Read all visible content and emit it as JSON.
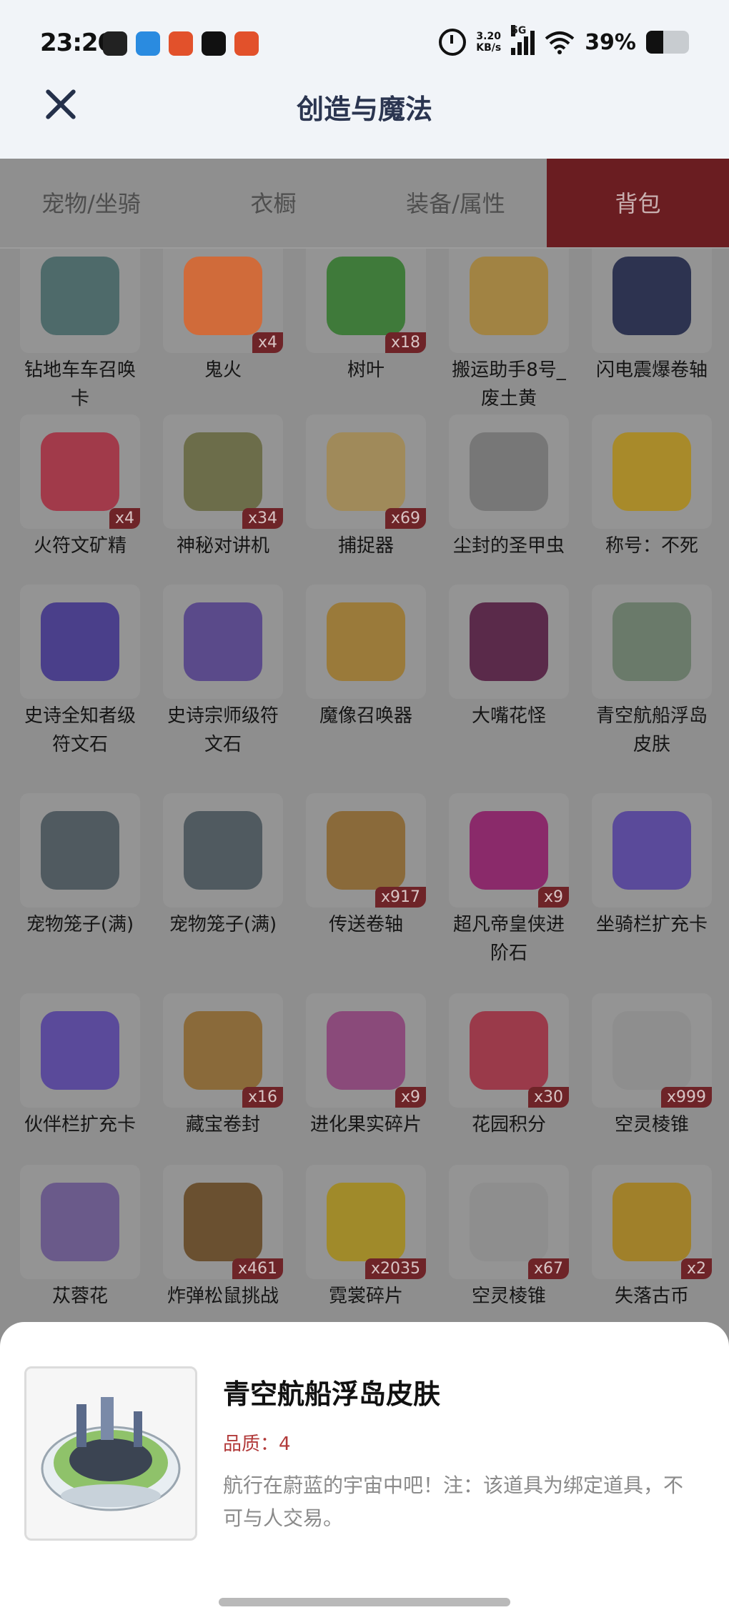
{
  "status_bar": {
    "time": "23:20",
    "net_speed_value": "3.20",
    "net_speed_unit": "KB/s",
    "network": "5G",
    "battery": "39%",
    "app_icon_colors": [
      "#222222",
      "#2a8be0",
      "#e2512b",
      "#111111",
      "#e2512b"
    ]
  },
  "header": {
    "title": "创造与魔法",
    "close_icon": "close-icon"
  },
  "tabs": [
    {
      "label": "宠物/坐骑",
      "active": false
    },
    {
      "label": "衣橱",
      "active": false
    },
    {
      "label": "装备/属性",
      "active": false
    },
    {
      "label": "背包",
      "active": true
    }
  ],
  "items": [
    {
      "name": "钻地车车召唤卡",
      "count": "",
      "color": "#4e6a6a"
    },
    {
      "name": "鬼火",
      "count": "x4",
      "color": "#d06b3a"
    },
    {
      "name": "树叶",
      "count": "x18",
      "color": "#3f7a3a"
    },
    {
      "name": "搬运助手8号_废土黄",
      "count": "",
      "color": "#a18343"
    },
    {
      "name": "闪电震爆卷轴",
      "count": "",
      "color": "#2d3350"
    },
    {
      "name": "火符文矿精",
      "count": "x4",
      "color": "#a13a4a"
    },
    {
      "name": "神秘对讲机",
      "count": "x34",
      "color": "#6c6d4a"
    },
    {
      "name": "捕捉器",
      "count": "x69",
      "color": "#a08a5a"
    },
    {
      "name": "尘封的圣甲虫",
      "count": "",
      "color": "#777777"
    },
    {
      "name": "称号：不死",
      "count": "",
      "color": "#a88a2a"
    },
    {
      "name": "史诗全知者级符文石",
      "count": "",
      "color": "#4a3f8a"
    },
    {
      "name": "史诗宗师级符文石",
      "count": "",
      "color": "#5a4a8a"
    },
    {
      "name": "魔像召唤器",
      "count": "",
      "color": "#9a7a3a"
    },
    {
      "name": "大嘴花怪",
      "count": "",
      "color": "#5a2a4a"
    },
    {
      "name": "青空航船浮岛皮肤",
      "count": "",
      "color": "#6a7a6a"
    },
    {
      "name": "宠物笼子(满)",
      "count": "",
      "color": "#505a60"
    },
    {
      "name": "宠物笼子(满)",
      "count": "",
      "color": "#505a60"
    },
    {
      "name": "传送卷轴",
      "count": "x917",
      "color": "#8a6a3a"
    },
    {
      "name": "超凡帝皇侠进阶石",
      "count": "x9",
      "color": "#8a2a6a"
    },
    {
      "name": "坐骑栏扩充卡",
      "count": "",
      "color": "#5a4a9a"
    },
    {
      "name": "伙伴栏扩充卡",
      "count": "",
      "color": "#5a4a9a"
    },
    {
      "name": "藏宝卷封",
      "count": "x16",
      "color": "#8a6a3a"
    },
    {
      "name": "进化果实碎片",
      "count": "x9",
      "color": "#8a4a7a"
    },
    {
      "name": "花园积分",
      "count": "x30",
      "color": "#9a3a4a"
    },
    {
      "name": "空灵棱锥",
      "count": "x999",
      "color": "#8e8e8e"
    },
    {
      "name": "苁蓉花",
      "count": "",
      "color": "#6a5a8a"
    },
    {
      "name": "炸弹松鼠挑战",
      "count": "x461",
      "color": "#6a5030"
    },
    {
      "name": "霓裳碎片",
      "count": "x2035",
      "color": "#a08a2a"
    },
    {
      "name": "空灵棱锥",
      "count": "x67",
      "color": "#8e8e8e"
    },
    {
      "name": "失落古币",
      "count": "x2",
      "color": "#a0802a"
    }
  ],
  "detail": {
    "name": "青空航船浮岛皮肤",
    "quality": "品质：4",
    "description": "航行在蔚蓝的宇宙中吧！注：该道具为绑定道具，不可与人交易。"
  }
}
